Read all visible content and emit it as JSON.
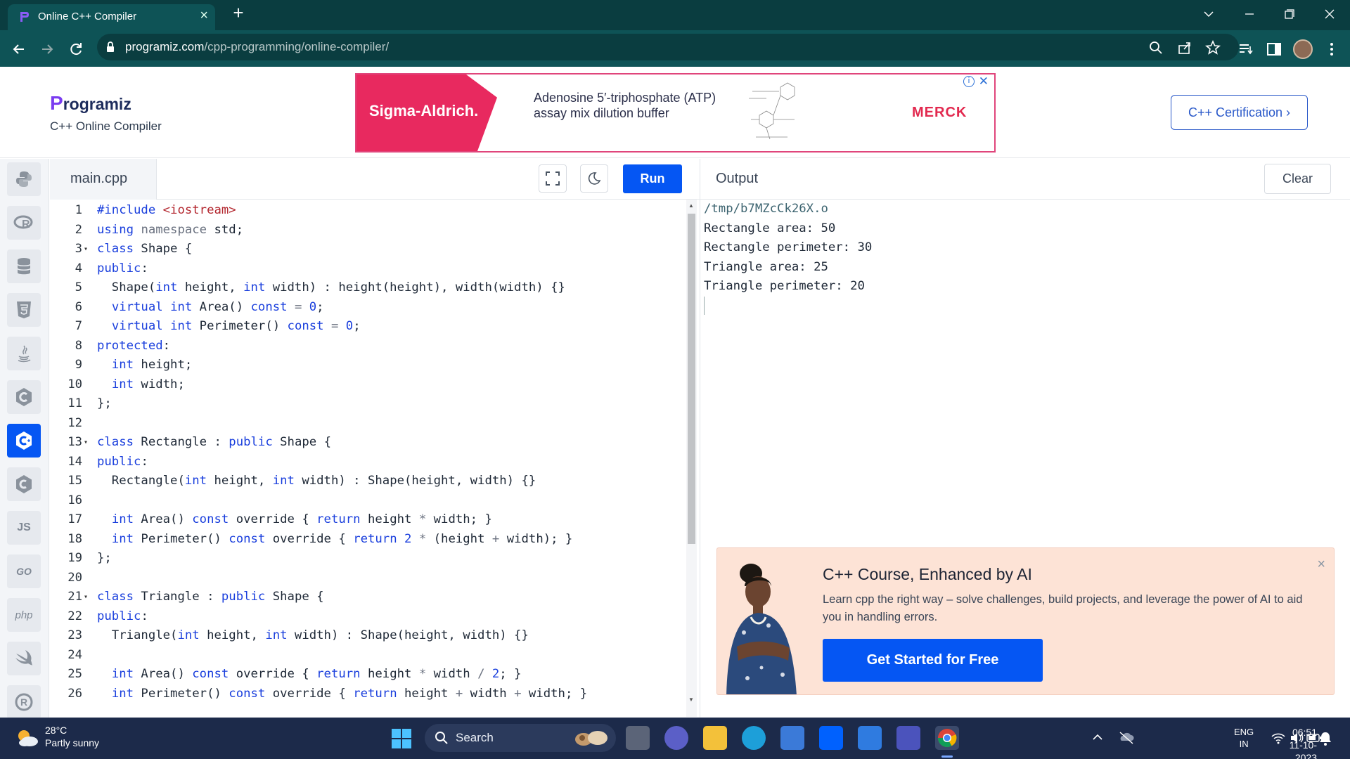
{
  "browser": {
    "tab_title": "Online C++ Compiler",
    "tab_close": "×",
    "new_tab": "+",
    "url_domain": "programiz.com",
    "url_path": "/cpp-programming/online-compiler/"
  },
  "header": {
    "logo_text": "Programiz",
    "subtitle": "C++ Online Compiler",
    "certification_button": "C++ Certification ›"
  },
  "ad": {
    "brand_left": "Sigma-Aldrich.",
    "text": "Adenosine 5′-triphosphate (ATP) assay mix dilution buffer",
    "brand_right": "MERCK"
  },
  "rail": {
    "items": [
      "python",
      "r",
      "sql",
      "html",
      "java",
      "c",
      "cpp",
      "csharp",
      "js",
      "go",
      "php",
      "swift",
      "rust"
    ],
    "active": "cpp",
    "js_label": "JS",
    "go_label": "GO",
    "php_label": "php"
  },
  "editor": {
    "filename": "main.cpp",
    "run_label": "Run",
    "lines": [
      {
        "n": "1",
        "fold": "",
        "code": "<span class='kw'>#include</span> <span class='inc'>&lt;iostream&gt;</span>"
      },
      {
        "n": "2",
        "fold": "",
        "code": "<span class='kw'>using</span> <span class='ns'>namespace</span> std;"
      },
      {
        "n": "3",
        "fold": "▾",
        "code": "<span class='kw'>class</span> Shape {"
      },
      {
        "n": "4",
        "fold": "",
        "code": "<span class='kw'>public</span>:"
      },
      {
        "n": "5",
        "fold": "",
        "code": "  Shape(<span class='kw'>int</span> height, <span class='kw'>int</span> width) : height(height), width(width) {}"
      },
      {
        "n": "6",
        "fold": "",
        "code": "  <span class='kw'>virtual</span> <span class='kw'>int</span> Area() <span class='kw'>const</span> <span class='ns'>=</span> <span class='num'>0</span>;"
      },
      {
        "n": "7",
        "fold": "",
        "code": "  <span class='kw'>virtual</span> <span class='kw'>int</span> Perimeter() <span class='kw'>const</span> <span class='ns'>=</span> <span class='num'>0</span>;"
      },
      {
        "n": "8",
        "fold": "",
        "code": "<span class='kw'>protected</span>:"
      },
      {
        "n": "9",
        "fold": "",
        "code": "  <span class='kw'>int</span> height;"
      },
      {
        "n": "10",
        "fold": "",
        "code": "  <span class='kw'>int</span> width;"
      },
      {
        "n": "11",
        "fold": "",
        "code": "};"
      },
      {
        "n": "12",
        "fold": "",
        "code": ""
      },
      {
        "n": "13",
        "fold": "▾",
        "code": "<span class='kw'>class</span> Rectangle : <span class='kw'>public</span> Shape {"
      },
      {
        "n": "14",
        "fold": "",
        "code": "<span class='kw'>public</span>:"
      },
      {
        "n": "15",
        "fold": "",
        "code": "  Rectangle(<span class='kw'>int</span> height, <span class='kw'>int</span> width) : Shape(height, width) {}"
      },
      {
        "n": "16",
        "fold": "",
        "code": ""
      },
      {
        "n": "17",
        "fold": "",
        "code": "  <span class='kw'>int</span> Area() <span class='kw'>const</span> override { <span class='kw'>return</span> height <span class='ns'>*</span> width; }"
      },
      {
        "n": "18",
        "fold": "",
        "code": "  <span class='kw'>int</span> Perimeter() <span class='kw'>const</span> override { <span class='kw'>return</span> <span class='num'>2</span> <span class='ns'>*</span> (height <span class='ns'>+</span> width); }"
      },
      {
        "n": "19",
        "fold": "",
        "code": "};"
      },
      {
        "n": "20",
        "fold": "",
        "code": ""
      },
      {
        "n": "21",
        "fold": "▾",
        "code": "<span class='kw'>class</span> Triangle : <span class='kw'>public</span> Shape {"
      },
      {
        "n": "22",
        "fold": "",
        "code": "<span class='kw'>public</span>:"
      },
      {
        "n": "23",
        "fold": "",
        "code": "  Triangle(<span class='kw'>int</span> height, <span class='kw'>int</span> width) : Shape(height, width) {}"
      },
      {
        "n": "24",
        "fold": "",
        "code": ""
      },
      {
        "n": "25",
        "fold": "",
        "code": "  <span class='kw'>int</span> Area() <span class='kw'>const</span> override { <span class='kw'>return</span> height <span class='ns'>*</span> width <span class='ns'>/</span> <span class='num'>2</span>; }"
      },
      {
        "n": "26",
        "fold": "",
        "code": "  <span class='kw'>int</span> Perimeter() <span class='kw'>const</span> override { <span class='kw'>return</span> height <span class='ns'>+</span> width <span class='ns'>+</span> width; }"
      }
    ]
  },
  "output": {
    "title": "Output",
    "clear_label": "Clear",
    "lines": [
      "/tmp/b7MZcCk26X.o",
      "Rectangle area: 50",
      "Rectangle perimeter: 30",
      "Triangle area: 25",
      "Triangle perimeter: 20"
    ]
  },
  "promo": {
    "title": "C++ Course, Enhanced by AI",
    "description": "Learn cpp the right way – solve challenges, build projects, and leverage the power of AI to aid you in handling errors.",
    "button": "Get Started for Free",
    "close": "×"
  },
  "taskbar": {
    "temperature": "28°C",
    "weather": "Partly sunny",
    "search_label": "Search",
    "lang_line1": "ENG",
    "lang_line2": "IN",
    "time": "06:51",
    "date": "11-10-2023"
  },
  "colors": {
    "accent": "#0556f3",
    "chrome_dark": "#0a3d40",
    "chrome": "#0e5356",
    "ad_red": "#e8295f",
    "promo_bg": "#fde3d6"
  }
}
